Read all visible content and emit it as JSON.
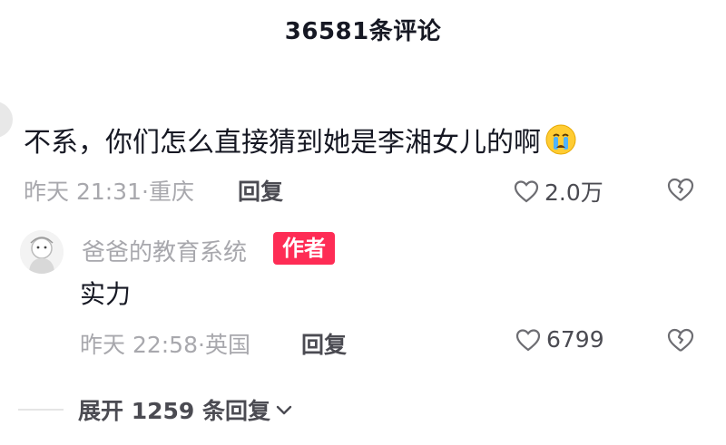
{
  "header": {
    "title": "36581条评论"
  },
  "comment": {
    "text": "不系，你们怎么直接猜到她是李湘女儿的啊",
    "emoji": "crying-face",
    "time_location": "昨天 21:31·重庆",
    "reply_label": "回复",
    "like_count": "2.0万"
  },
  "reply": {
    "author": "爸爸的教育系统",
    "badge": "作者",
    "badge_color": "#fe2c55",
    "text": "实力",
    "time_location": "昨天 22:58·英国",
    "reply_label": "回复",
    "like_count": "6799"
  },
  "expand": {
    "label": "展开 1259 条回复"
  },
  "icons": {
    "like": "heart-outline-icon",
    "dislike": "broken-heart-icon",
    "expand": "chevron-down-icon"
  }
}
